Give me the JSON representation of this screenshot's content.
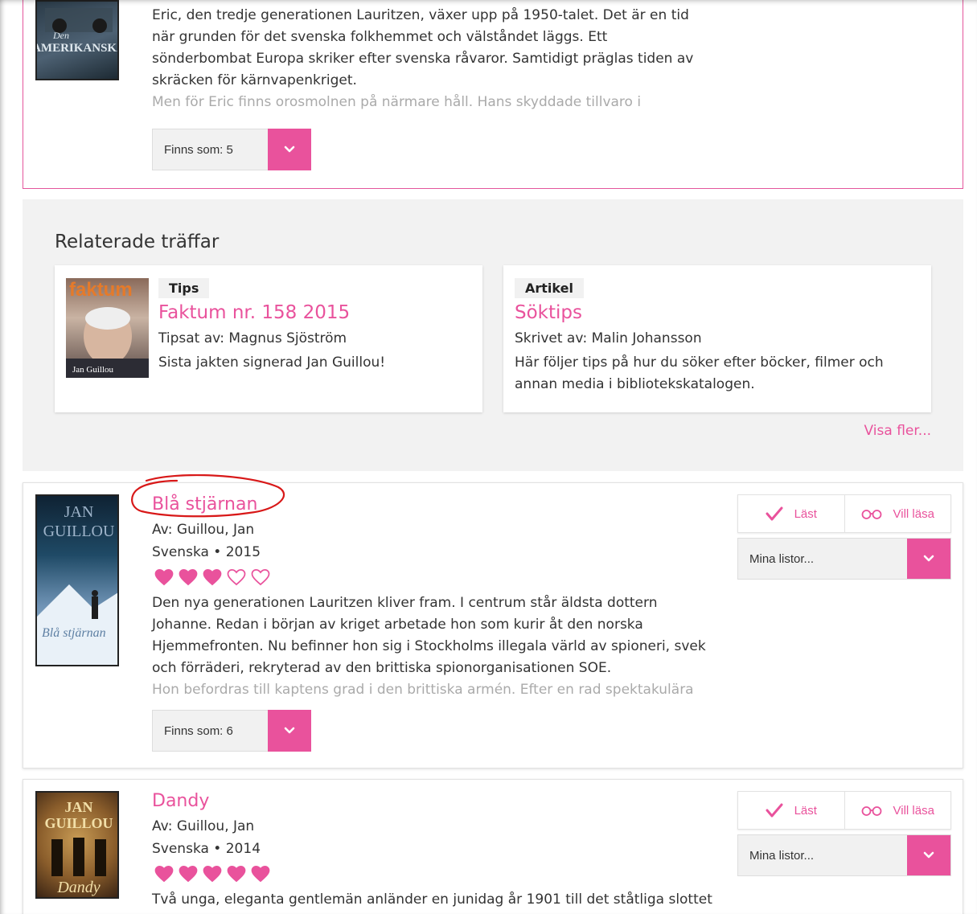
{
  "colors": {
    "accent": "#e9529c",
    "text": "#333333",
    "muted": "#aaaaaa",
    "panel": "#f2f2f2"
  },
  "top_book": {
    "cover_text": [
      "AMERIKANSKA",
      "Den"
    ],
    "description_lines": [
      "Eric, den tredje generationen Lauritzen, växer upp på 1950-talet. Det är en tid",
      "när grunden för det svenska folkhemmet och välståndet läggs. Ett",
      "sönderbombat Europa skriker efter svenska råvaror. Samtidigt präglas tiden av",
      "skräcken för kärnvapenkriget."
    ],
    "description_fade": "Men för Eric finns orosmolnen på närmare håll. Hans skyddade tillvaro i",
    "finns_label": "Finns som:  5"
  },
  "related": {
    "heading": "Relaterade träffar",
    "cards": [
      {
        "tag": "Tips",
        "title": "Faktum nr. 158 2015",
        "byline": "Tipsat av: Magnus Sjöström",
        "text": "Sista jakten signerad Jan Guillou!",
        "cover_text": [
          "faktum",
          "Jan Guillou"
        ]
      },
      {
        "tag": "Artikel",
        "title": "Söktips",
        "byline": "Skrivet av: Malin Johansson",
        "text_lines": [
          "Här följer tips på hur du söker efter böcker, filmer och",
          "annan media i bibliotekskatalogen."
        ]
      }
    ],
    "more_link": "Visa fler..."
  },
  "books": [
    {
      "title": "Blå stjärnan",
      "author": "Av: Guillou, Jan",
      "lang_year": "Svenska  •  2015",
      "rating": 3,
      "cover_text": [
        "JAN",
        "GUILLOU",
        "Blå stjärnan"
      ],
      "description_lines": [
        "Den nya generationen Lauritzen kliver fram. I centrum står äldsta dottern",
        "Johanne. Redan i början av kriget arbetade hon som kurir åt den norska",
        "Hjemmefronten. Nu befinner hon sig i Stockholms illegala värld av spioneri, svek",
        "och förräderi, rekryterad av den brittiska spionorganisationen SOE."
      ],
      "description_fade": "Hon befordras till kaptens grad i den brittiska armén. Efter en rad spektakulära",
      "finns_label": "Finns som:  6",
      "read_label": "Läst",
      "want_label": "Vill läsa",
      "lists_label": "Mina listor..."
    },
    {
      "title": "Dandy",
      "author": "Av: Guillou, Jan",
      "lang_year": "Svenska  •  2014",
      "rating": 5,
      "cover_text": [
        "JAN",
        "GUILLOU",
        "Dandy"
      ],
      "description_lines": [
        "Två unga, eleganta gentlemän anländer en junidag år 1901 till det ståtliga slottet"
      ],
      "read_label": "Läst",
      "want_label": "Vill läsa",
      "lists_label": "Mina listor..."
    }
  ]
}
